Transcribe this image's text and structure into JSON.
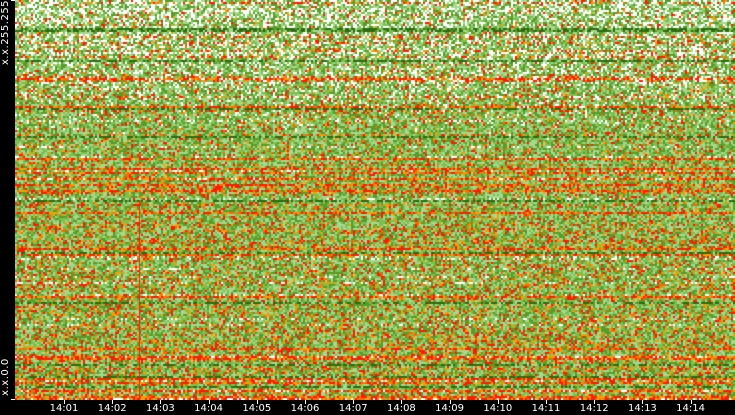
{
  "chart_data": {
    "type": "heatmap",
    "title": "",
    "xlabel": "",
    "ylabel": "",
    "x_ticks": [
      "14:01",
      "14:02",
      "14:03",
      "14:04",
      "14:05",
      "14:06",
      "14:07",
      "14:08",
      "14:09",
      "14:10",
      "14:11",
      "14:12",
      "14:13",
      "14:14"
    ],
    "x_range": [
      "14:00",
      "14:14:45"
    ],
    "y_labels": {
      "top": "x.x.255.255",
      "bottom": "x.x.0.0"
    },
    "color_scale": [
      "#ffffff",
      "#a8d890",
      "#7cc050",
      "#5a9a28",
      "#2d6a10",
      "#f5a000",
      "#ff6a00",
      "#ff1a00"
    ],
    "color_scale_meaning": "low to high activity",
    "notable_features": [
      "vertical red line near 14:02:35",
      "many horizontal red bands across all times"
    ]
  }
}
